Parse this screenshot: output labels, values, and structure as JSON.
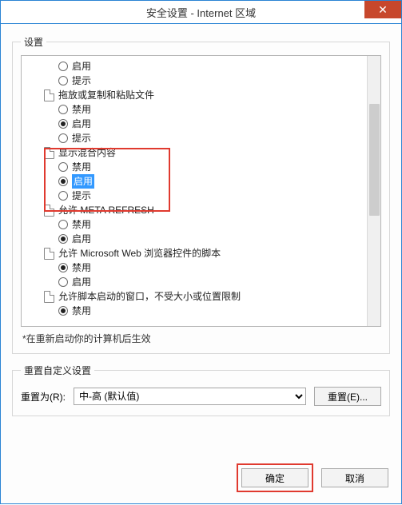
{
  "window": {
    "title": "安全设置 - Internet 区域"
  },
  "settings": {
    "legend": "设置",
    "restart_note": "*在重新启动你的计算机后生效",
    "visibleOptions": [
      {
        "type": "option",
        "label": "启用",
        "checked": false
      },
      {
        "type": "option",
        "label": "提示",
        "checked": false
      },
      {
        "type": "category",
        "label": "拖放或复制和粘贴文件"
      },
      {
        "type": "option",
        "label": "禁用",
        "checked": false
      },
      {
        "type": "option",
        "label": "启用",
        "checked": true
      },
      {
        "type": "option",
        "label": "提示",
        "checked": false
      },
      {
        "type": "category",
        "label": "显示混合内容"
      },
      {
        "type": "option",
        "label": "禁用",
        "checked": false
      },
      {
        "type": "option",
        "label": "启用",
        "checked": true,
        "selected": true
      },
      {
        "type": "option",
        "label": "提示",
        "checked": false
      },
      {
        "type": "category",
        "label": "允许 META REFRESH"
      },
      {
        "type": "option",
        "label": "禁用",
        "checked": false
      },
      {
        "type": "option",
        "label": "启用",
        "checked": true
      },
      {
        "type": "category",
        "label": "允许 Microsoft Web 浏览器控件的脚本"
      },
      {
        "type": "option",
        "label": "禁用",
        "checked": true
      },
      {
        "type": "option",
        "label": "启用",
        "checked": false
      },
      {
        "type": "category",
        "label": "允许脚本启动的窗口，不受大小或位置限制"
      },
      {
        "type": "option",
        "label": "禁用",
        "checked": true
      }
    ]
  },
  "reset": {
    "legend": "重置自定义设置",
    "label": "重置为(R):",
    "selected": "中-高 (默认值)",
    "button": "重置(E)..."
  },
  "footer": {
    "ok": "确定",
    "cancel": "取消"
  }
}
